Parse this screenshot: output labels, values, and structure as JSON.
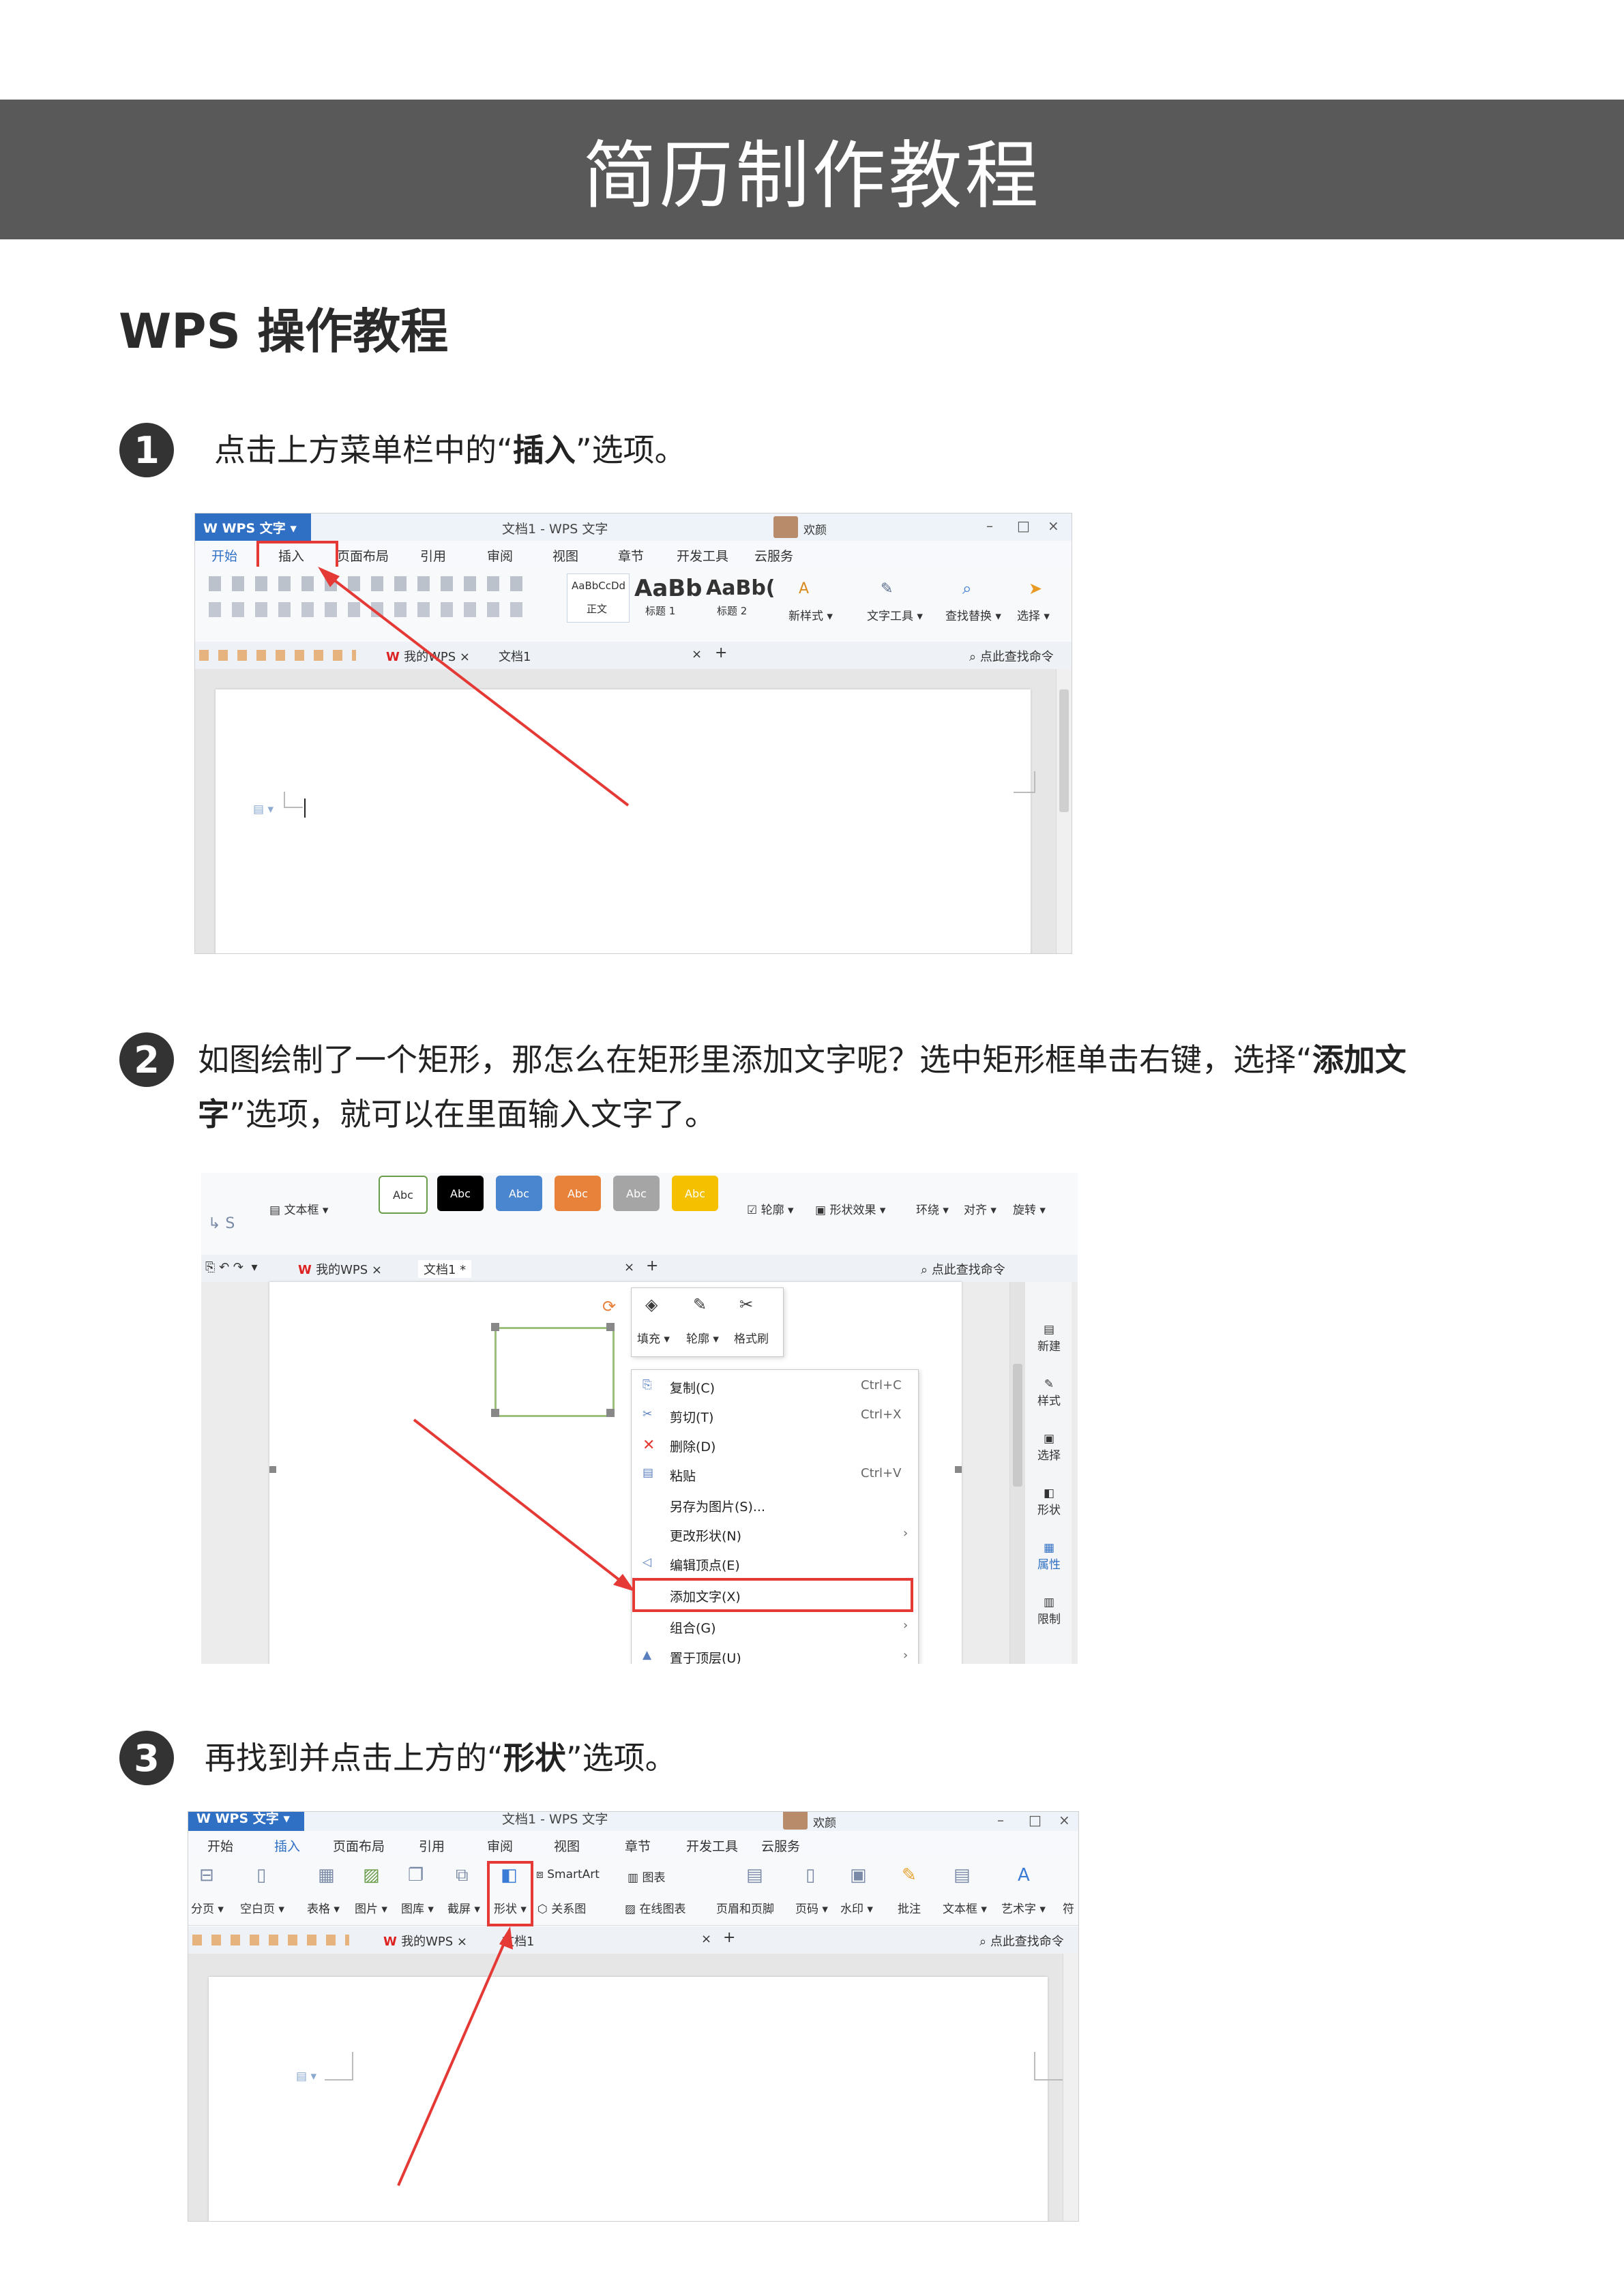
{
  "banner": {
    "title": "简历制作教程"
  },
  "section": {
    "title": "WPS 操作教程"
  },
  "steps": [
    {
      "num": "1",
      "pre": "点击上方菜单栏中的“",
      "bold": "插入",
      "post": "”选项。"
    },
    {
      "num": "2",
      "pre": "如图绘制了一个矩形，那怎么在矩形里添加文字呢？选中矩形框单击右键，选择“",
      "bold": "添加文字",
      "post": "”选项，就可以在里面输入文字了。",
      "line1": "如图绘制了一个矩形，那怎么在矩形里添加文字呢？选中矩形框单击右键，选择“",
      "bold1": "添加文",
      "bold2": "字",
      "line2": "”选项，就可以在里面输入文字了。"
    },
    {
      "num": "3",
      "pre": "再找到并点击上方的“",
      "bold": "形状",
      "post": "”选项。"
    }
  ],
  "shot1": {
    "app": "W WPS 文字 ▾",
    "doc_title": "文档1 - WPS 文字",
    "welcome": "欢颜",
    "menus": [
      "开始",
      "插入",
      "页面布局",
      "引用",
      "审阅",
      "视图",
      "章节",
      "开发工具",
      "云服务"
    ],
    "styles": [
      {
        "sample": "AaBbCcDd",
        "name": "正文"
      },
      {
        "sample": "AaBb",
        "name": "标题 1"
      },
      {
        "sample": "AaBb(",
        "name": "标题 2"
      }
    ],
    "tools": [
      "新样式 ▾",
      "文字工具 ▾",
      "查找替换 ▾",
      "选择 ▾"
    ],
    "tabs": [
      "我的WPS",
      "文档1"
    ],
    "search": "点此查找命令"
  },
  "shot2": {
    "tools_row": [
      "文本框 ▾",
      "轮廓 ▾",
      "形状效果 ▾",
      "环绕 ▾",
      "对齐 ▾",
      "旋转 ▾"
    ],
    "swatches": [
      "Abc",
      "Abc",
      "Abc",
      "Abc",
      "Abc",
      "Abc"
    ],
    "tabs": [
      "我的WPS",
      "文档1 *"
    ],
    "search": "点此查找命令",
    "mini_toolbar": [
      "填充 ▾",
      "轮廓 ▾",
      "格式刷"
    ],
    "context_menu": [
      {
        "label": "复制(C)",
        "key": "Ctrl+C"
      },
      {
        "label": "剪切(T)",
        "key": "Ctrl+X"
      },
      {
        "label": "删除(D)",
        "key": ""
      },
      {
        "label": "粘贴",
        "key": "Ctrl+V"
      },
      {
        "label": "另存为图片(S)...",
        "key": ""
      },
      {
        "label": "更改形状(N)",
        "key": "›"
      },
      {
        "label": "编辑顶点(E)",
        "key": ""
      },
      {
        "label": "添加文字(X)",
        "key": ""
      },
      {
        "label": "组合(G)",
        "key": "›"
      },
      {
        "label": "置于顶层(U)",
        "key": "›"
      }
    ],
    "side_panel": [
      "新建",
      "样式",
      "选择",
      "形状",
      "属性",
      "限制"
    ]
  },
  "shot3": {
    "app": "W WPS 文字 ▾",
    "doc_title": "文档1 - WPS 文字",
    "welcome": "欢颜",
    "menus": [
      "开始",
      "插入",
      "页面布局",
      "引用",
      "审阅",
      "视图",
      "章节",
      "开发工具",
      "云服务"
    ],
    "tools": [
      "分页 ▾",
      "空白页 ▾",
      "表格 ▾",
      "图片 ▾",
      "图库 ▾",
      "截屏 ▾",
      "形状 ▾",
      "关系图",
      "在线图表",
      "页眉和页脚",
      "页码 ▾",
      "水印 ▾",
      "批注",
      "文本框 ▾",
      "艺术字 ▾",
      "符"
    ],
    "smartart": "SmartArt",
    "chart": "图表",
    "tabs": [
      "我的WPS",
      "文档1"
    ],
    "search": "点此查找命令"
  }
}
